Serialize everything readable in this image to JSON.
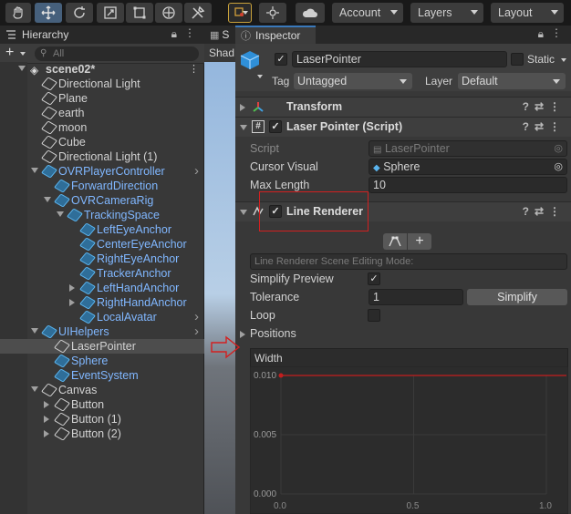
{
  "toolbar": {
    "account_label": "Account",
    "layers_label": "Layers",
    "layout_label": "Layout"
  },
  "hierarchy": {
    "tab_label": "Hierarchy",
    "search_placeholder": "All",
    "items": [
      {
        "label": "scene02*",
        "indent": 0,
        "arrow": "down",
        "blue": false
      },
      {
        "label": "Directional Light",
        "indent": 1,
        "blue": false
      },
      {
        "label": "Plane",
        "indent": 1,
        "blue": false
      },
      {
        "label": "earth",
        "indent": 1,
        "blue": false
      },
      {
        "label": "moon",
        "indent": 1,
        "blue": false
      },
      {
        "label": "Cube",
        "indent": 1,
        "blue": false
      },
      {
        "label": "Directional Light (1)",
        "indent": 1,
        "blue": false
      },
      {
        "label": "OVRPlayerController",
        "indent": 1,
        "arrow": "down",
        "blue": true
      },
      {
        "label": "ForwardDirection",
        "indent": 2,
        "blue": true
      },
      {
        "label": "OVRCameraRig",
        "indent": 2,
        "arrow": "down",
        "blue": true
      },
      {
        "label": "TrackingSpace",
        "indent": 3,
        "arrow": "down",
        "blue": true
      },
      {
        "label": "LeftEyeAnchor",
        "indent": 4,
        "blue": true
      },
      {
        "label": "CenterEyeAnchor",
        "indent": 4,
        "blue": true
      },
      {
        "label": "RightEyeAnchor",
        "indent": 4,
        "blue": true
      },
      {
        "label": "TrackerAnchor",
        "indent": 4,
        "blue": true
      },
      {
        "label": "LeftHandAnchor",
        "indent": 4,
        "arrow": "right",
        "blue": true
      },
      {
        "label": "RightHandAnchor",
        "indent": 4,
        "arrow": "right",
        "blue": true
      },
      {
        "label": "LocalAvatar",
        "indent": 4,
        "blue": true
      },
      {
        "label": "UIHelpers",
        "indent": 1,
        "arrow": "down",
        "blue": true
      },
      {
        "label": "LaserPointer",
        "indent": 2,
        "blue": false
      },
      {
        "label": "Sphere",
        "indent": 2,
        "blue": true
      },
      {
        "label": "EventSystem",
        "indent": 2,
        "blue": true
      },
      {
        "label": "Canvas",
        "indent": 1,
        "arrow": "down",
        "blue": false
      },
      {
        "label": "Button",
        "indent": 2,
        "arrow": "right",
        "blue": false
      },
      {
        "label": "Button (1)",
        "indent": 2,
        "arrow": "right",
        "blue": false
      },
      {
        "label": "Button (2)",
        "indent": 2,
        "arrow": "right",
        "blue": false
      }
    ]
  },
  "scene": {
    "tab_label": "S",
    "shading_label": "Shad"
  },
  "inspector": {
    "tab_label": "Inspector",
    "object_name": "LaserPointer",
    "static_label": "Static",
    "tag_label": "Tag",
    "tag_value": "Untagged",
    "layer_label": "Layer",
    "layer_value": "Default",
    "transform": {
      "title": "Transform"
    },
    "laser_pointer": {
      "title": "Laser Pointer (Script)",
      "script_label": "Script",
      "script_value": "LaserPointer",
      "cursor_label": "Cursor Visual",
      "cursor_value": "Sphere",
      "maxlen_label": "Max Length",
      "maxlen_value": "10"
    },
    "line_renderer": {
      "title": "Line Renderer",
      "scene_mode_label": "Line Renderer Scene Editing Mode:",
      "simplify_preview_label": "Simplify Preview",
      "tolerance_label": "Tolerance",
      "tolerance_value": "1",
      "simplify_button": "Simplify",
      "loop_label": "Loop",
      "positions_label": "Positions",
      "width_label": "Width"
    }
  },
  "chart_data": {
    "type": "line",
    "title": "Width",
    "x": [
      0.0,
      1.0
    ],
    "y": [
      0.01,
      0.01
    ],
    "xlim": [
      0.0,
      1.0
    ],
    "ylim": [
      0.0,
      0.01
    ],
    "x_ticks": [
      "0.0",
      "0.5",
      "1.0"
    ],
    "y_ticks": [
      "0.010",
      "0.005",
      "0.000"
    ],
    "line_color": "#c41e1e"
  },
  "colors": {
    "accent_blue": "#80b7ff",
    "selection": "#4d4d4d",
    "annotation_red": "#d32020"
  }
}
